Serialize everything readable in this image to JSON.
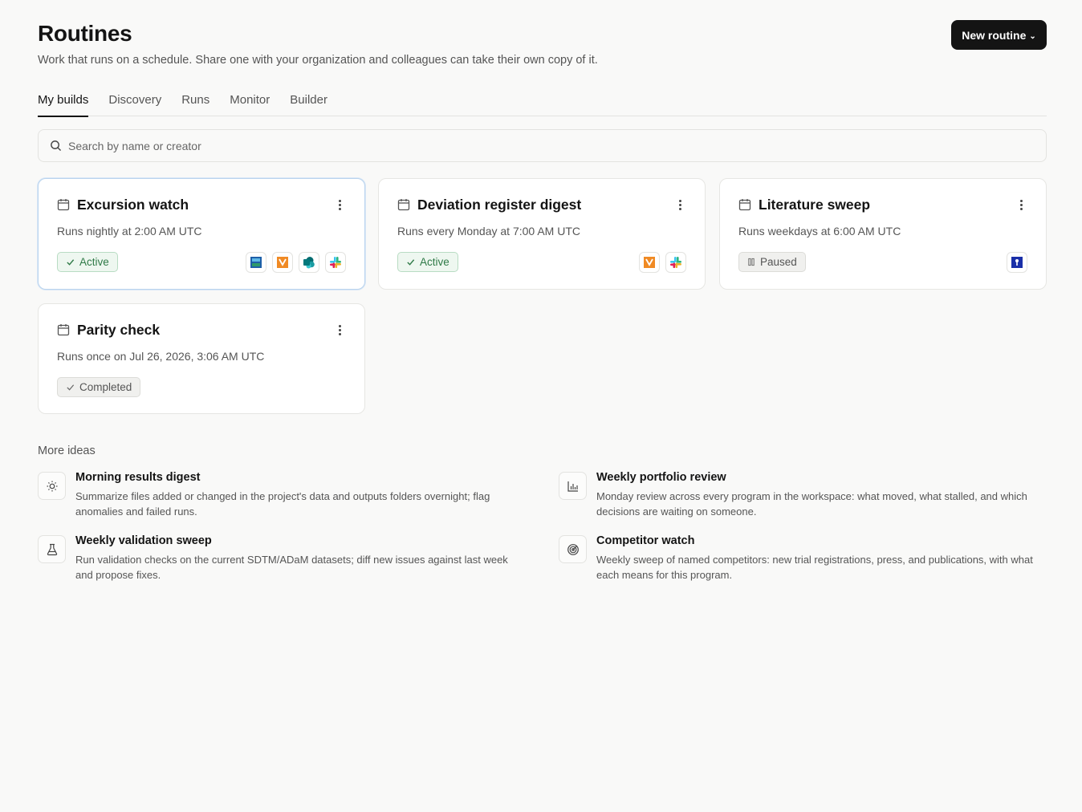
{
  "header": {
    "title": "Routines",
    "subtitle": "Work that runs on a schedule. Share one with your organization and colleagues can take their own copy of it.",
    "new_button": "New routine",
    "new_button_chevron": "⌄"
  },
  "tabs": [
    {
      "label": "My builds",
      "active": true
    },
    {
      "label": "Discovery",
      "active": false
    },
    {
      "label": "Runs",
      "active": false
    },
    {
      "label": "Monitor",
      "active": false
    },
    {
      "label": "Builder",
      "active": false
    }
  ],
  "search": {
    "placeholder": "Search by name or creator",
    "value": ""
  },
  "routines": [
    {
      "title": "Excursion watch",
      "schedule": "Runs nightly at 2:00 AM UTC",
      "status": "Active",
      "status_icon": "check-icon",
      "selected": true,
      "apps": [
        "ledger-app-icon",
        "veeva-app-icon",
        "sharepoint-app-icon",
        "slack-app-icon"
      ]
    },
    {
      "title": "Deviation register digest",
      "schedule": "Runs every Monday at 7:00 AM UTC",
      "status": "Active",
      "status_icon": "check-icon",
      "selected": false,
      "apps": [
        "veeva-app-icon",
        "slack-app-icon"
      ]
    },
    {
      "title": "Literature sweep",
      "schedule": "Runs weekdays at 6:00 AM UTC",
      "status": "Paused",
      "status_icon": "pause-icon",
      "selected": false,
      "apps": [
        "pubmed-app-icon"
      ]
    },
    {
      "title": "Parity check",
      "schedule": "Runs once on Jul 26, 2026, 3:06 AM UTC",
      "status": "Completed",
      "status_icon": "check-icon",
      "selected": false,
      "apps": []
    }
  ],
  "ideas": {
    "title": "More ideas",
    "items": [
      {
        "icon": "sun-icon",
        "title": "Morning results digest",
        "desc": "Summarize files added or changed in the project's data and outputs folders overnight; flag anomalies and failed runs."
      },
      {
        "icon": "bar-chart-icon",
        "title": "Weekly portfolio review",
        "desc": "Monday review across every program in the workspace: what moved, what stalled, and which decisions are waiting on someone."
      },
      {
        "icon": "flask-icon",
        "title": "Weekly validation sweep",
        "desc": "Run validation checks on the current SDTM/ADaM datasets; diff new issues against last week and propose fixes."
      },
      {
        "icon": "radar-icon",
        "title": "Competitor watch",
        "desc": "Weekly sweep of named competitors: new trial registrations, press, and publications, with what each means for this program."
      }
    ]
  },
  "colors": {
    "background": "#f9f9f8",
    "primary_button": "#141414",
    "active_badge_bg": "#eef7f0",
    "active_badge_text": "#2f7a47",
    "selected_card_border": "#b9d3ee"
  }
}
